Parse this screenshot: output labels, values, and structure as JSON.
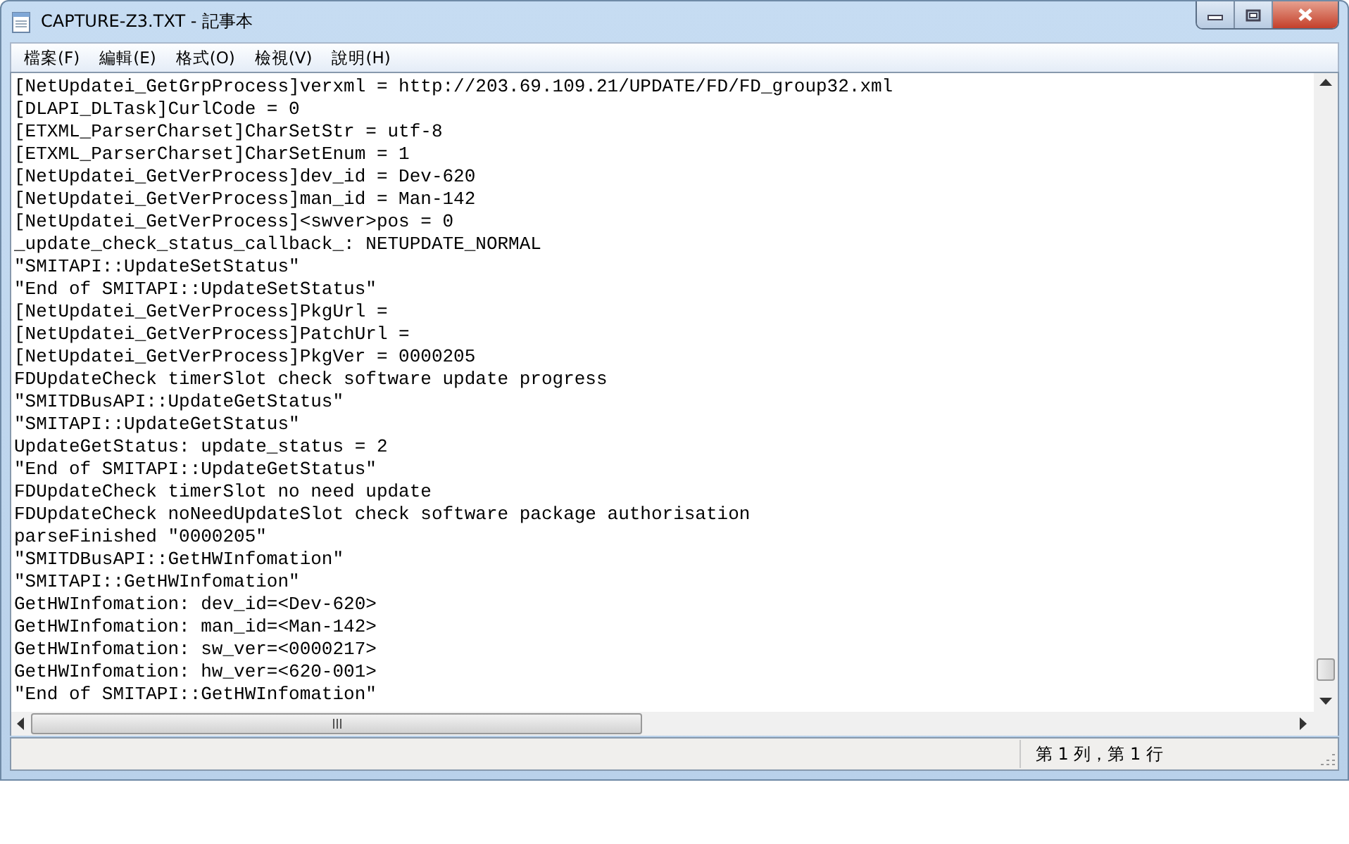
{
  "window": {
    "title": "CAPTURE-Z3.TXT - 記事本"
  },
  "menu": [
    "檔案(F)",
    "編輯(E)",
    "格式(O)",
    "檢視(V)",
    "說明(H)"
  ],
  "lines": [
    "[NetUpdatei_GetGrpProcess]verxml = http://203.69.109.21/UPDATE/FD/FD_group32.xml",
    "[DLAPI_DLTask]CurlCode = 0",
    "[ETXML_ParserCharset]CharSetStr = utf-8",
    "[ETXML_ParserCharset]CharSetEnum = 1",
    "[NetUpdatei_GetVerProcess]dev_id = Dev-620",
    "[NetUpdatei_GetVerProcess]man_id = Man-142",
    "[NetUpdatei_GetVerProcess]<swver>pos = 0",
    "_update_check_status_callback_: NETUPDATE_NORMAL",
    "\"SMITAPI::UpdateSetStatus\"",
    "\"End of SMITAPI::UpdateSetStatus\"",
    "[NetUpdatei_GetVerProcess]PkgUrl =",
    "[NetUpdatei_GetVerProcess]PatchUrl =",
    "[NetUpdatei_GetVerProcess]PkgVer = 0000205",
    "FDUpdateCheck timerSlot check software update progress",
    "\"SMITDBusAPI::UpdateGetStatus\"",
    "\"SMITAPI::UpdateGetStatus\"",
    "UpdateGetStatus: update_status = 2",
    "\"End of SMITAPI::UpdateGetStatus\"",
    "FDUpdateCheck timerSlot no need update",
    "FDUpdateCheck noNeedUpdateSlot check software package authorisation",
    "parseFinished \"0000205\"",
    "\"SMITDBusAPI::GetHWInfomation\"",
    "\"SMITAPI::GetHWInfomation\"",
    "GetHWInfomation: dev_id=<Dev-620>",
    "GetHWInfomation: man_id=<Man-142>",
    "GetHWInfomation: sw_ver=<0000217>",
    "GetHWInfomation: hw_ver=<620-001>",
    "\"End of SMITAPI::GetHWInfomation\""
  ],
  "status_bar": {
    "position": "第 1 列，第 1 行"
  }
}
